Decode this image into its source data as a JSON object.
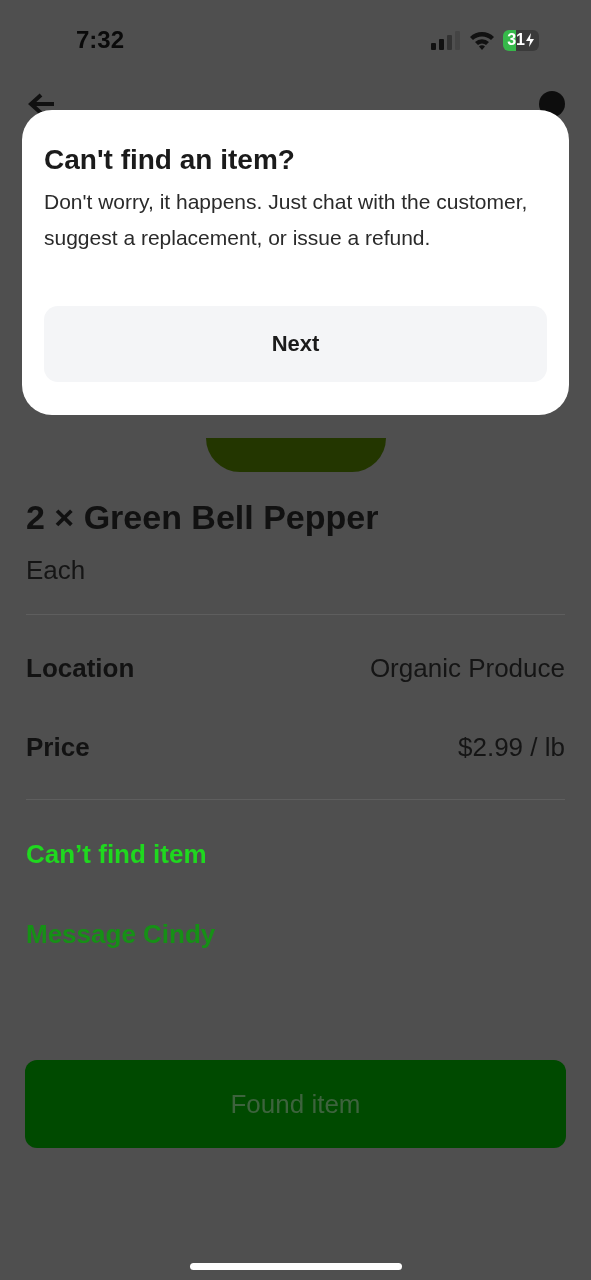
{
  "status_bar": {
    "time": "7:32",
    "battery": "31"
  },
  "dialog": {
    "title": "Can't find an item?",
    "body": "Don't worry, it happens. Just chat with the customer, suggest a replacement, or issue a refund.",
    "button": "Next"
  },
  "item": {
    "title": "2 × Green Bell Pepper",
    "unit": "Each"
  },
  "details": [
    {
      "label": "Location",
      "value": "Organic Produce"
    },
    {
      "label": "Price",
      "value": "$2.99 / lb"
    }
  ],
  "links": [
    {
      "label": "Can’t find item",
      "highlighted": true
    },
    {
      "label": "Message Cindy",
      "highlighted": false
    }
  ],
  "primary_button": {
    "label": "Found item",
    "disabled": true
  }
}
